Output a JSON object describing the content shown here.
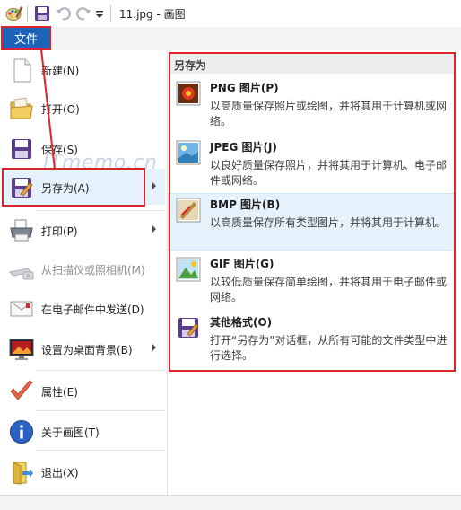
{
  "window": {
    "title": "11.jpg - 画图"
  },
  "file_tab": {
    "label": "文件"
  },
  "menu": {
    "new": "新建(N)",
    "open": "打开(O)",
    "save": "保存(S)",
    "save_as": "另存为(A)",
    "print": "打印(P)",
    "scan": "从扫描仪或照相机(M)",
    "email": "在电子邮件中发送(D)",
    "desktop_bg": "设置为桌面背景(B)",
    "properties": "属性(E)",
    "about": "关于画图(T)",
    "exit": "退出(X)"
  },
  "watermark": "ITmemo.cn",
  "submenu": {
    "title": "另存为",
    "items": [
      {
        "title": "PNG 图片(P)",
        "desc": "以高质量保存照片或绘图，并将其用于计算机或网络。"
      },
      {
        "title": "JPEG 图片(J)",
        "desc": "以良好质量保存照片，并将其用于计算机、电子邮件或网络。"
      },
      {
        "title": "BMP 图片(B)",
        "desc": "以高质量保存所有类型图片，并将其用于计算机。"
      },
      {
        "title": "GIF 图片(G)",
        "desc": "以较低质量保存简单绘图，并将其用于电子邮件或网络。"
      },
      {
        "title": "其他格式(O)",
        "desc": "打开“另存为”对话框，从所有可能的文件类型中进行选择。"
      }
    ]
  },
  "colors": {
    "file_tab": "#1d63b7",
    "annotation_red": "#d9262c",
    "hover": "#e5f1fb"
  }
}
